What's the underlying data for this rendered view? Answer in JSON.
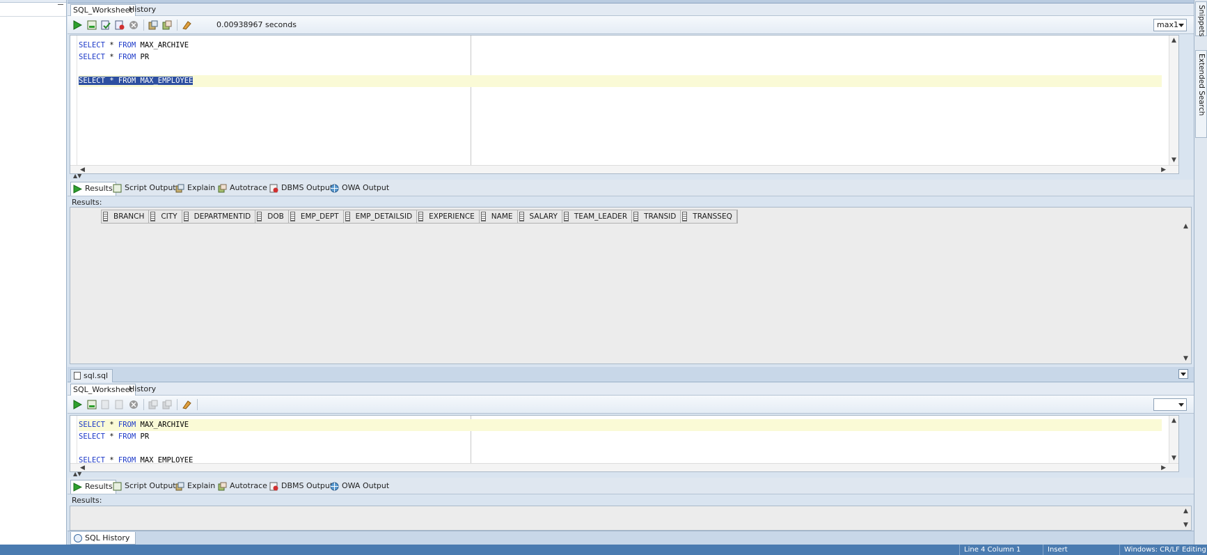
{
  "upper": {
    "tabs": [
      "SQL_Worksheet",
      "History"
    ],
    "timing": "0.00938967 seconds",
    "connection": "max1",
    "code": {
      "l1_kw1": "SELECT",
      "l1_mid": " * ",
      "l1_kw2": "FROM",
      "l1_obj": " MAX_ARCHIVE",
      "l2_kw1": "SELECT",
      "l2_mid": " * ",
      "l2_kw2": "FROM",
      "l2_obj": " PR",
      "l4_sel": "SELECT * FROM MAX_EMPLOYEE"
    },
    "result_tabs": [
      "Results",
      "Script Output",
      "Explain",
      "Autotrace",
      "DBMS Output",
      "OWA Output"
    ],
    "results_label": "Results:",
    "columns": [
      "BRANCH",
      "CITY",
      "DEPARTMENTID",
      "DOB",
      "EMP_DEPT",
      "EMP_DETAILSID",
      "EXPERIENCE",
      "NAME",
      "SALARY",
      "TEAM_LEADER",
      "TRANSID",
      "TRANSSEQ"
    ]
  },
  "lower": {
    "file_tab": "sql.sql",
    "tabs": [
      "SQL_Worksheet",
      "History"
    ],
    "code": {
      "l1_kw1": "SELECT",
      "l1_mid": " * ",
      "l1_kw2": "FROM",
      "l1_obj": " MAX_ARCHIVE",
      "l2_kw1": "SELECT",
      "l2_mid": " * ",
      "l2_kw2": "FROM",
      "l2_obj": " PR",
      "l4_kw1": "SELECT",
      "l4_mid": " * ",
      "l4_kw2": "FROM",
      "l4_obj": " MAX_EMPLOYEE"
    },
    "result_tabs": [
      "Results",
      "Script Output",
      "Explain",
      "Autotrace",
      "DBMS Output",
      "OWA Output"
    ],
    "results_label": "Results:"
  },
  "sql_history_tab": "SQL History",
  "side_tabs": [
    "Snippets",
    "Extended Search"
  ],
  "status": {
    "position": "Line 4 Column 1",
    "mode": "Insert",
    "edition": "Windows: CR/LF  Editing"
  }
}
